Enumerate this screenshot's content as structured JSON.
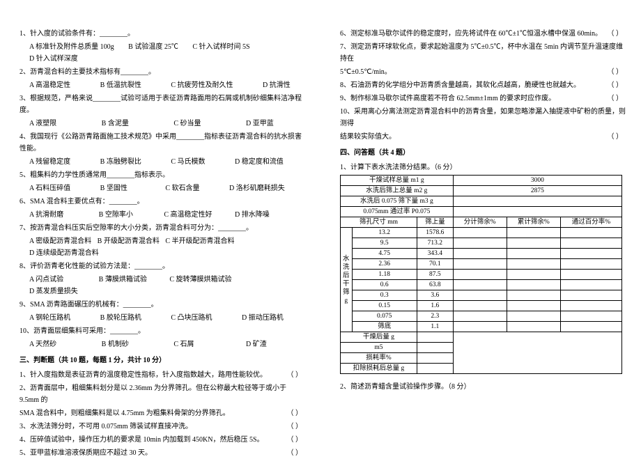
{
  "left": {
    "q1": "1、针入度的试验条件有：________。",
    "q1opts": [
      "A  标准针及附件总质量 100g",
      "B  试验温度 25℃",
      "C  针入试样时间 5S",
      "D  针入试样深度"
    ],
    "q2": "2、沥青混合料的主要技术指标有________。",
    "q2opts": [
      "A  高温稳定性",
      "B  低温抗裂性",
      "C  抗疲劳性及耐久性",
      "D  抗滑性"
    ],
    "q3": "3、根据规范，严格来说________试验可适用于表征沥青路面用的石屑或机制砂细集料洁净程度。",
    "q3opts": [
      "A  液塑限",
      "B  含泥量",
      "C  砂当量",
      "D  亚甲蓝"
    ],
    "q4": "4、我国现行《公路沥青路面施工技术规范》中采用________指标表征沥青混合料的抗水损害性能。",
    "q4opts": [
      "A  残留稳定度",
      "B  冻融劈裂比",
      "C  马氏模数",
      "D  稳定度和流值"
    ],
    "q5": "5、粗集料的力学性质通常用________指标表示。",
    "q5opts": [
      "A  石料压碎值",
      "B  坚固性",
      "C  软石含量",
      "D  洛杉矶磨耗损失"
    ],
    "q6": "6、SMA 混合料主要优点有：________。",
    "q6opts": [
      "A  抗滑耐磨",
      "B  空隙率小",
      "C  高温稳定性好",
      "D  排水降噪"
    ],
    "q7": "7、按沥青混合料压实后空隙率的大小分类，沥青混合料可分为：________。",
    "q7opts": [
      "A  密级配沥青混合料",
      "B  开级配沥青混合料",
      "C  半开级配沥青混合料",
      "D  连续级配沥青混合料"
    ],
    "q8": "8、评价沥青老化性能的试验方法是：________。",
    "q8opts": [
      "A  闪点试验",
      "B  薄膜烘箱试验",
      "C  旋转薄膜烘箱试验",
      "D  蒸发质量损失"
    ],
    "q9": "9、SMA 沥青路面碾压的机械有：________。",
    "q9opts": [
      "A  钢轮压路机",
      "B  胶轮压路机",
      "C  凸块压路机",
      "D  振动压路机"
    ],
    "q10": "10、沥青面层细集料可采用：________。",
    "q10opts": [
      "A  天然砂",
      "B  机制砂",
      "C  石屑",
      "D  矿渣"
    ],
    "sec3": "三、判断题（共 10 题，每题 1 分，共计 10 分）",
    "j1": "1、针入度指数是表征沥青的温度稳定性指标，针入度指数越大，路用性能较优。",
    "j2a": "2、沥青面层中，粗细集料划分是以 2.36mm 为分界筛孔。但在公称最大粒径等于或小于 9.5mm 的",
    "j2b": "SMA 混合料中，则粗细集料是以 4.75mm 为粗集料骨架的分界筛孔。",
    "j3": "3、水洗法筛分时，不可用 0.075mm 筛装试样直接冲洗。",
    "j4": "4、压碎值试验中，操作压力机的要求是 10min 内加载到 450KN，然后稳压 5S。",
    "j5": "5、亚甲蓝标准溶液保质期应不超过 30 天。"
  },
  "right": {
    "j6": "6、测定标准马歇尔试件的稳定度时，应先将试件在 60℃±1℃恒温水槽中保温 60min。",
    "j7a": "7、测定沥青环球软化点，要求起始温度为 5℃±0.5℃，杯中水温在 5min 内调节至升温速度维持在",
    "j7b": "5℃±0.5℃/min。",
    "j8": "8、石油沥青的化学组分中沥青质含量越高，其软化点越高，脆硬性也就越大。",
    "j9": "9、制作标准马歇尔试件高度若不符合 62.5mm±1mm 的要求时应作废。",
    "j10a": "10、采用离心分离法测定沥青混合料中的沥青含量，如果忽略渗漏入抽提液中矿粉的质量，则测得",
    "j10b": "结果较实际值大。",
    "sec4": "四、问答题（共 4 题）",
    "q1r": "1、计算下表水洗法筛分结果。（6 分）",
    "table": {
      "r1": [
        "干燥试样总量 m1 g",
        "3000"
      ],
      "r2": [
        "水洗后筛上总量 m2 g",
        "2875"
      ],
      "r3": [
        "水洗后 0.075 筛下量 m3 g",
        ""
      ],
      "r4": [
        "0.075mm 通过率 P0.075",
        ""
      ],
      "hdr": [
        "筛孔尺寸 mm",
        "筛上量",
        "分计筛余%",
        "累计筛余%",
        "通过百分率%"
      ],
      "sizes": [
        "13.2",
        "9.5",
        "4.75",
        "2.36",
        "1.18",
        "0.6",
        "0.3",
        "0.15",
        "0.075",
        "筛底"
      ],
      "mass": [
        "1578.6",
        "713.2",
        "343.4",
        "70.1",
        "87.5",
        "63.8",
        "3.6",
        "1.6",
        "2.3",
        "1.1"
      ],
      "rowLabel": "水洗后干筛 g",
      "b1": "干燥后量 g",
      "b2": "m5",
      "b3": "损耗率%",
      "b4": "扣除损耗后总量 g"
    },
    "q2r": "2、简述沥青蜡含量试验操作步骤。（8 分）"
  },
  "paren": "（        ）"
}
